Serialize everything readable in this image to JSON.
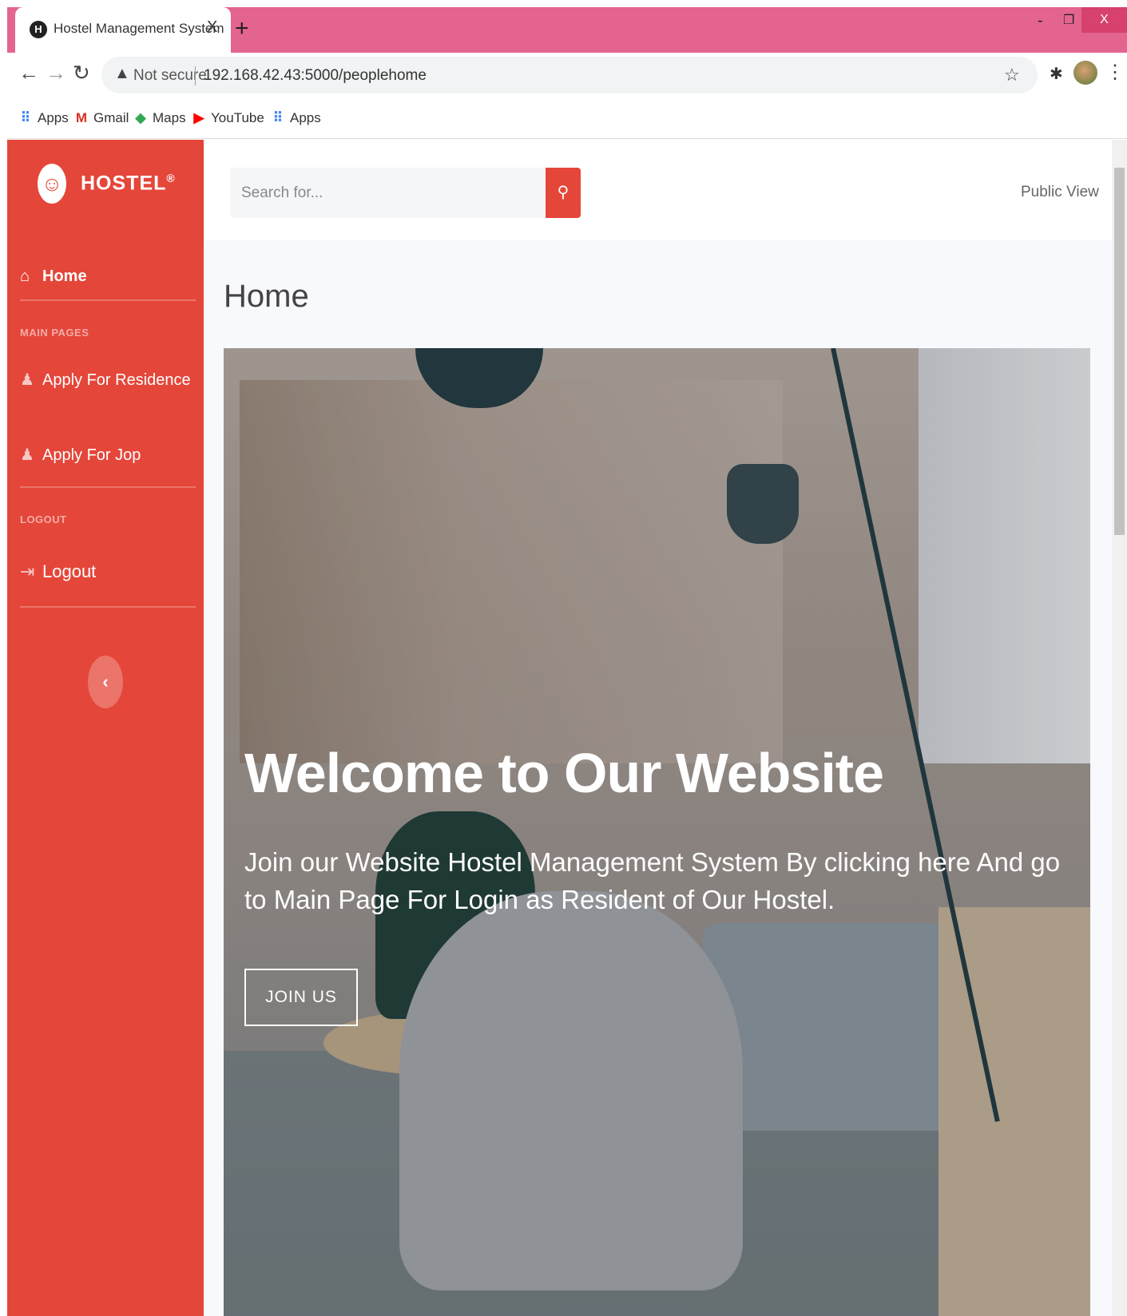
{
  "browser": {
    "tab_title": "Hostel Management System",
    "tab_close": "X",
    "new_tab": "+",
    "window_controls": {
      "minimize": "-",
      "restore": "❐",
      "close": "X"
    },
    "security_label": "Not secure",
    "url": "192.168.42.43:5000/peoplehome",
    "bookmarks": [
      {
        "label": "Apps",
        "icon": "apps-grid-icon"
      },
      {
        "label": "Gmail",
        "icon": "gmail-icon"
      },
      {
        "label": "Maps",
        "icon": "maps-icon"
      },
      {
        "label": "YouTube",
        "icon": "youtube-icon"
      },
      {
        "label": "Apps",
        "icon": "apps-grid-icon"
      }
    ]
  },
  "sidebar": {
    "brand": "HOSTEL",
    "brand_sup": "®",
    "home": "Home",
    "section_main": "MAIN PAGES",
    "items": [
      {
        "label": "Apply For Residence",
        "icon": "user-icon"
      },
      {
        "label": "Apply For Jop",
        "icon": "user-plus-icon"
      }
    ],
    "section_logout": "LOGOUT",
    "logout": "Logout",
    "toggle": "‹"
  },
  "topbar": {
    "search_placeholder": "Search for...",
    "public_view": "Public View"
  },
  "main": {
    "page_title": "Home",
    "hero": {
      "title": "Welcome to Our Website",
      "text": "Join our Website Hostel Management System By clicking here And go to Main Page For Login as Resident of Our Hostel.",
      "button": "JOIN US"
    }
  },
  "colors": {
    "tabbar": "#e46490",
    "sidebar": "#e5463a",
    "accent": "#e5463a"
  }
}
